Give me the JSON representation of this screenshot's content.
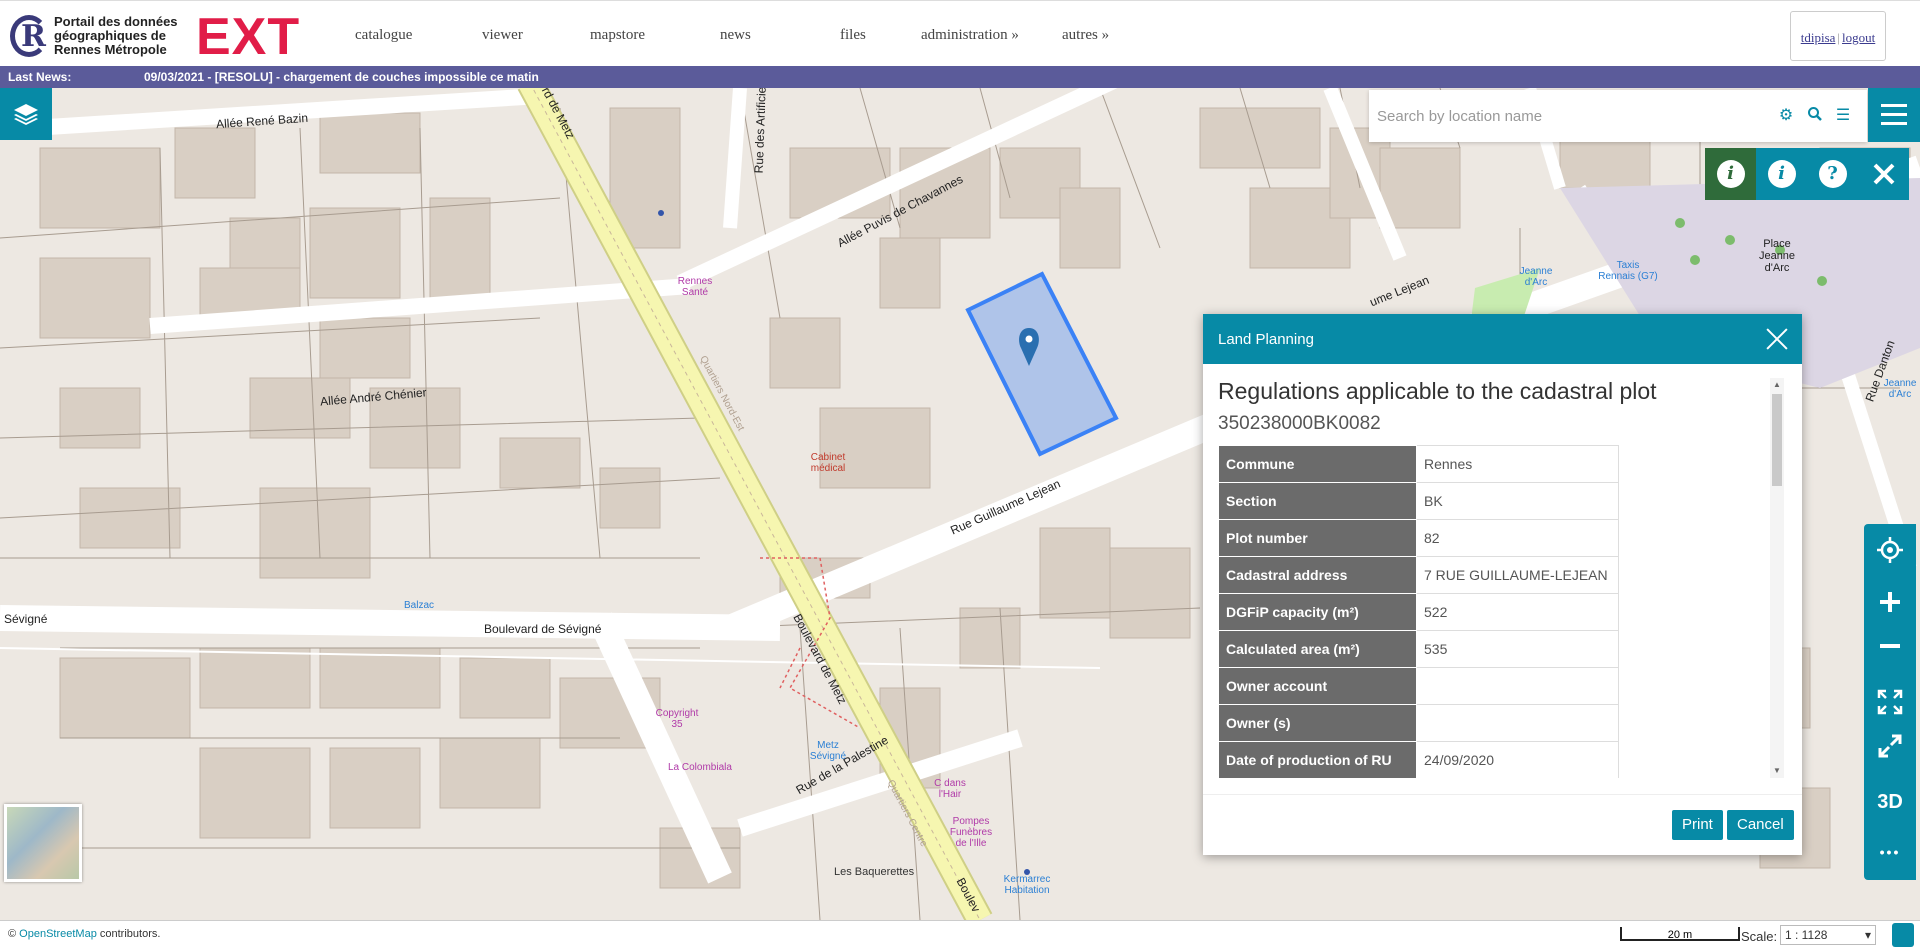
{
  "header": {
    "logo_text": "Portail des données géographiques de Rennes Métropole",
    "logo_ext": "EXT",
    "nav": [
      "catalogue",
      "viewer",
      "mapstore",
      "news",
      "files",
      "administration »",
      "autres »"
    ],
    "user": "tdipisa",
    "logout": "logout"
  },
  "news": {
    "label": "Last News:",
    "message": "09/03/2021 - [RESOLU] - chargement de couches impossible ce matin"
  },
  "search": {
    "placeholder": "Search by location name"
  },
  "map": {
    "roads": [
      "Allée René Bazin",
      "Allée André Chénier",
      "Boulevard de Sévigné",
      "Sévigné",
      "Boulevard de Metz",
      "Rue Guillaume Lejean",
      "Rue de la Palestine",
      "Allée Puvis de Chavannes",
      "Rue des Artificiers",
      "Quartiers Nord-Est",
      "Quartiers Centre",
      "Rue Danton",
      "ume Lejean",
      "rd de Metz",
      "Boulev"
    ],
    "pois": [
      "Rennes Santé",
      "Cabinet médical",
      "Balzac",
      "Copyright 35",
      "La Colombiala",
      "Metz Sévigné",
      "C dans l'Hair",
      "Pompes Funèbres de l'Ille",
      "Kermarrec Habitation",
      "Les Baquerettes",
      "Taxis Rennais (G7)",
      "Jeanne d'Arc",
      "Place Jeanne d'Arc",
      "Jeanne d'Arc"
    ]
  },
  "dialog": {
    "header": "Land Planning",
    "title": "Regulations applicable to the cadastral plot",
    "plot_id": "350238000BK0082",
    "rows": [
      {
        "key": "Commune",
        "value": "Rennes"
      },
      {
        "key": "Section",
        "value": "BK"
      },
      {
        "key": "Plot number",
        "value": "82"
      },
      {
        "key": "Cadastral address",
        "value": "7 RUE GUILLAUME-LEJEAN"
      },
      {
        "key": "DGFiP capacity (m²)",
        "value": "522"
      },
      {
        "key": "Calculated area (m²)",
        "value": "535"
      },
      {
        "key": "Owner account",
        "value": ""
      },
      {
        "key": "Owner (s)",
        "value": ""
      },
      {
        "key": "Date of production of RU",
        "value": "24/09/2020"
      }
    ],
    "print": "Print",
    "cancel": "Cancel"
  },
  "zoom_controls": {
    "three_d": "3D",
    "more": "•••"
  },
  "footer": {
    "attribution_prefix": "©",
    "attribution_link": "OpenStreetMap",
    "attribution_suffix": "contributors.",
    "scalebar": "20 m",
    "scale_label": "Scale:",
    "scale_value": "1 : 1128"
  },
  "colors": {
    "accent": "#078aa6",
    "news_bar": "#5b5b9a",
    "brand_red": "#e11d48",
    "selected_plot": "#3b82f6"
  }
}
